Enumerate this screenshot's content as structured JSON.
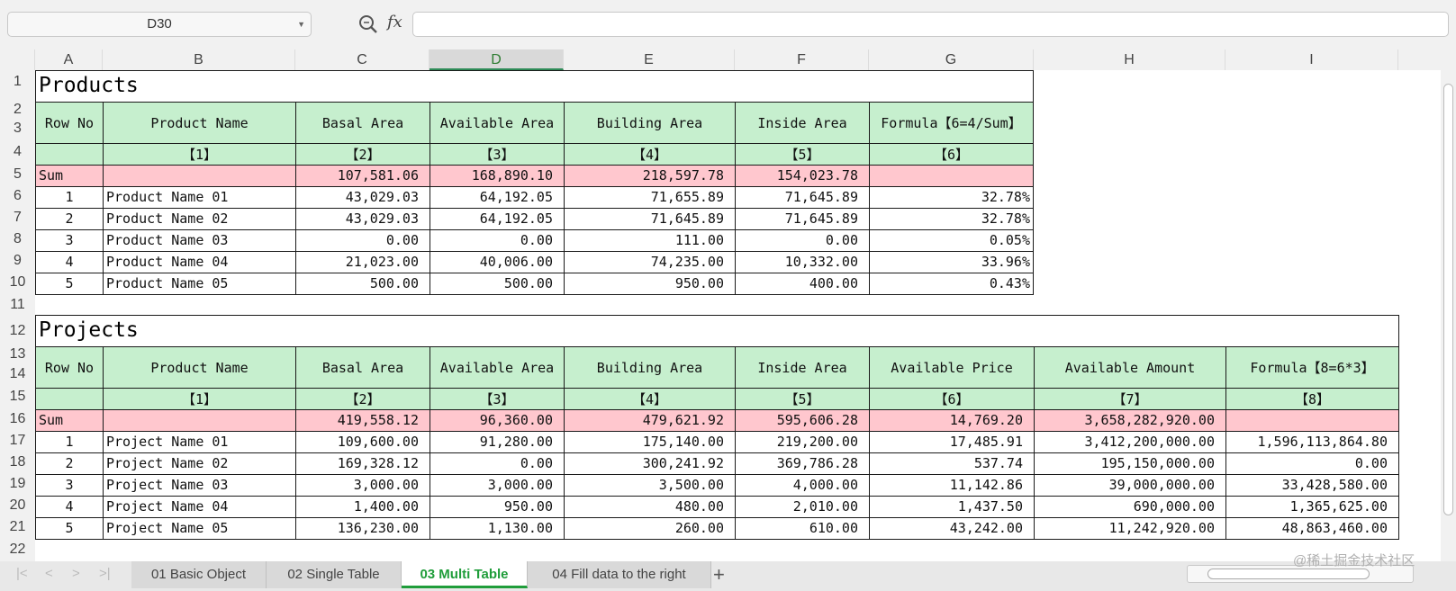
{
  "toolbar": {
    "name_box": "D30",
    "fx_label": "fx",
    "formula_value": ""
  },
  "columns": [
    "A",
    "B",
    "C",
    "D",
    "E",
    "F",
    "G",
    "H",
    "I"
  ],
  "rows": [
    "1",
    "2",
    "3",
    "4",
    "5",
    "6",
    "7",
    "8",
    "9",
    "10",
    "11",
    "12",
    "13",
    "14",
    "15",
    "16",
    "17",
    "18",
    "19",
    "20",
    "21",
    "22"
  ],
  "products": {
    "title": "Products",
    "headers": [
      "Row No",
      "Product Name",
      "Basal Area",
      "Available Area",
      "Building Area",
      "Inside Area",
      "Formula【6=4/Sum】"
    ],
    "indices": [
      "",
      "【1】",
      "【2】",
      "【3】",
      "【4】",
      "【5】",
      "【6】"
    ],
    "sum": [
      "Sum",
      "",
      "107,581.06",
      "168,890.10",
      "218,597.78",
      "154,023.78",
      ""
    ],
    "data": [
      [
        "1",
        "Product Name 01",
        "43,029.03",
        "64,192.05",
        "71,655.89",
        "71,645.89",
        "32.78%"
      ],
      [
        "2",
        "Product Name 02",
        "43,029.03",
        "64,192.05",
        "71,645.89",
        "71,645.89",
        "32.78%"
      ],
      [
        "3",
        "Product Name 03",
        "0.00",
        "0.00",
        "111.00",
        "0.00",
        "0.05%"
      ],
      [
        "4",
        "Product Name 04",
        "21,023.00",
        "40,006.00",
        "74,235.00",
        "10,332.00",
        "33.96%"
      ],
      [
        "5",
        "Product Name 05",
        "500.00",
        "500.00",
        "950.00",
        "400.00",
        "0.43%"
      ]
    ]
  },
  "projects": {
    "title": "Projects",
    "headers": [
      "Row No",
      "Product Name",
      "Basal Area",
      "Available Area",
      "Building Area",
      "Inside Area",
      "Available Price",
      "Available Amount",
      "Formula【8=6*3】"
    ],
    "indices": [
      "",
      "【1】",
      "【2】",
      "【3】",
      "【4】",
      "【5】",
      "【6】",
      "【7】",
      "【8】"
    ],
    "sum": [
      "Sum",
      "",
      "419,558.12",
      "96,360.00",
      "479,621.92",
      "595,606.28",
      "14,769.20",
      "3,658,282,920.00",
      ""
    ],
    "data": [
      [
        "1",
        "Project Name 01",
        "109,600.00",
        "91,280.00",
        "175,140.00",
        "219,200.00",
        "17,485.91",
        "3,412,200,000.00",
        "1,596,113,864.80"
      ],
      [
        "2",
        "Project Name 02",
        "169,328.12",
        "0.00",
        "300,241.92",
        "369,786.28",
        "537.74",
        "195,150,000.00",
        "0.00"
      ],
      [
        "3",
        "Project Name 03",
        "3,000.00",
        "3,000.00",
        "3,500.00",
        "4,000.00",
        "11,142.86",
        "39,000,000.00",
        "33,428,580.00"
      ],
      [
        "4",
        "Project Name 04",
        "1,400.00",
        "950.00",
        "480.00",
        "2,010.00",
        "1,437.50",
        "690,000.00",
        "1,365,625.00"
      ],
      [
        "5",
        "Project Name 05",
        "136,230.00",
        "1,130.00",
        "260.00",
        "610.00",
        "43,242.00",
        "11,242,920.00",
        "48,863,460.00"
      ]
    ]
  },
  "sheet_tabs": [
    "01 Basic Object",
    "02 Single Table",
    "03 Multi Table",
    "04 Fill data to the right"
  ],
  "active_tab": "03 Multi Table",
  "add_tab_label": "+",
  "watermark": "@稀土掘金技术社区",
  "colors": {
    "header_green": "#c6efce",
    "sum_pink": "#ffc7ce",
    "active_tab": "#1f9d3a"
  }
}
